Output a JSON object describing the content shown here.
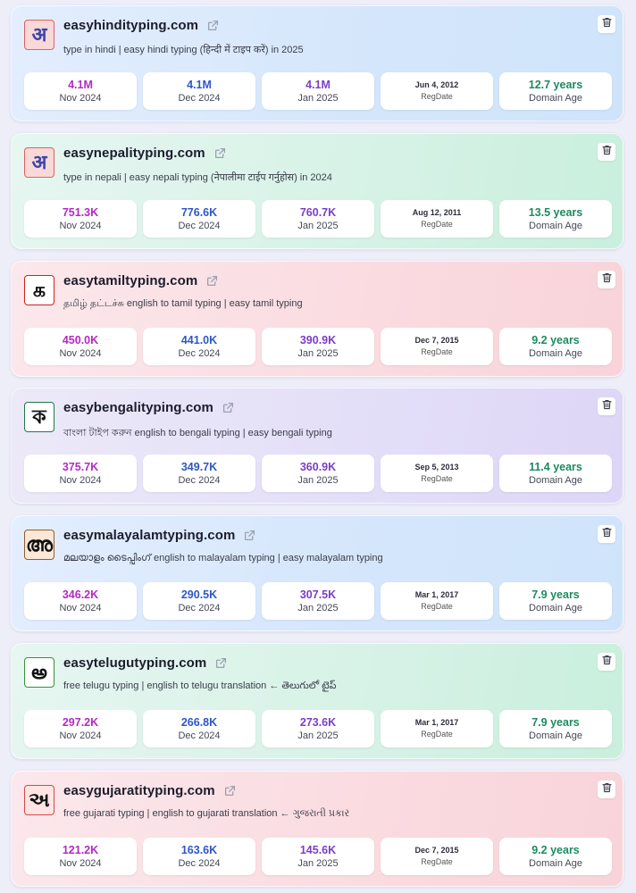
{
  "sites": [
    {
      "glyph": "अ",
      "logo_class": "l-hi",
      "theme": "blue",
      "domain": "easyhindityping.com",
      "subtitle": "type in hindi | easy hindi typing (हिन्दी में टाइप करें) in 2025",
      "nov": "4.1M",
      "nov_label": "Nov 2024",
      "dec": "4.1M",
      "dec_label": "Dec 2024",
      "jan": "4.1M",
      "jan_label": "Jan 2025",
      "reg": "Jun 4, 2012",
      "reg_label": "RegDate",
      "age": "12.7 years",
      "age_label": "Domain Age"
    },
    {
      "glyph": "अ",
      "logo_class": "l-ne",
      "theme": "green",
      "domain": "easynepalityping.com",
      "subtitle": "type in nepali | easy nepali typing (नेपालीमा टाईप गर्नुहोस) in 2024",
      "nov": "751.3K",
      "nov_label": "Nov 2024",
      "dec": "776.6K",
      "dec_label": "Dec 2024",
      "jan": "760.7K",
      "jan_label": "Jan 2025",
      "reg": "Aug 12, 2011",
      "reg_label": "RegDate",
      "age": "13.5 years",
      "age_label": "Domain Age"
    },
    {
      "glyph": "க",
      "logo_class": "l-ta",
      "theme": "pink",
      "domain": "easytamiltyping.com",
      "subtitle": "தமிழ் தட்டச்சு english to tamil typing | easy tamil typing",
      "nov": "450.0K",
      "nov_label": "Nov 2024",
      "dec": "441.0K",
      "dec_label": "Dec 2024",
      "jan": "390.9K",
      "jan_label": "Jan 2025",
      "reg": "Dec 7, 2015",
      "reg_label": "RegDate",
      "age": "9.2 years",
      "age_label": "Domain Age"
    },
    {
      "glyph": "ক",
      "logo_class": "l-bn",
      "theme": "purple",
      "domain": "easybengalityping.com",
      "subtitle": "বাংলা টাইপ করুন english to bengali typing | easy bengali typing",
      "nov": "375.7K",
      "nov_label": "Nov 2024",
      "dec": "349.7K",
      "dec_label": "Dec 2024",
      "jan": "360.9K",
      "jan_label": "Jan 2025",
      "reg": "Sep 5, 2013",
      "reg_label": "RegDate",
      "age": "11.4 years",
      "age_label": "Domain Age"
    },
    {
      "glyph": "അ",
      "logo_class": "l-ml",
      "theme": "blue",
      "domain": "easymalayalamtyping.com",
      "subtitle": "മലയാളം ടൈപ്പിംഗ് english to malayalam typing | easy malayalam typing",
      "nov": "346.2K",
      "nov_label": "Nov 2024",
      "dec": "290.5K",
      "dec_label": "Dec 2024",
      "jan": "307.5K",
      "jan_label": "Jan 2025",
      "reg": "Mar 1, 2017",
      "reg_label": "RegDate",
      "age": "7.9 years",
      "age_label": "Domain Age"
    },
    {
      "glyph": "అ",
      "logo_class": "l-te",
      "theme": "green",
      "domain": "easytelugutyping.com",
      "subtitle": "free telugu typing | english to telugu translation ← తెలుగులో టైప్",
      "nov": "297.2K",
      "nov_label": "Nov 2024",
      "dec": "266.8K",
      "dec_label": "Dec 2024",
      "jan": "273.6K",
      "jan_label": "Jan 2025",
      "reg": "Mar 1, 2017",
      "reg_label": "RegDate",
      "age": "7.9 years",
      "age_label": "Domain Age"
    },
    {
      "glyph": "અ",
      "logo_class": "l-gu",
      "theme": "pink",
      "domain": "easygujaratityping.com",
      "subtitle": "free gujarati typing | english to gujarati translation ← ગુજરાતી પ્રકાર",
      "nov": "121.2K",
      "nov_label": "Nov 2024",
      "dec": "163.6K",
      "dec_label": "Dec 2024",
      "jan": "145.6K",
      "jan_label": "Jan 2025",
      "reg": "Dec 7, 2015",
      "reg_label": "RegDate",
      "age": "9.2 years",
      "age_label": "Domain Age"
    }
  ],
  "icons": {
    "external": "external-link-icon",
    "delete": "trash-icon"
  },
  "colors": {
    "nov": "#b22ac4",
    "dec": "#2f56c8",
    "jan": "#7a3ec8",
    "age": "#1d8a60"
  }
}
